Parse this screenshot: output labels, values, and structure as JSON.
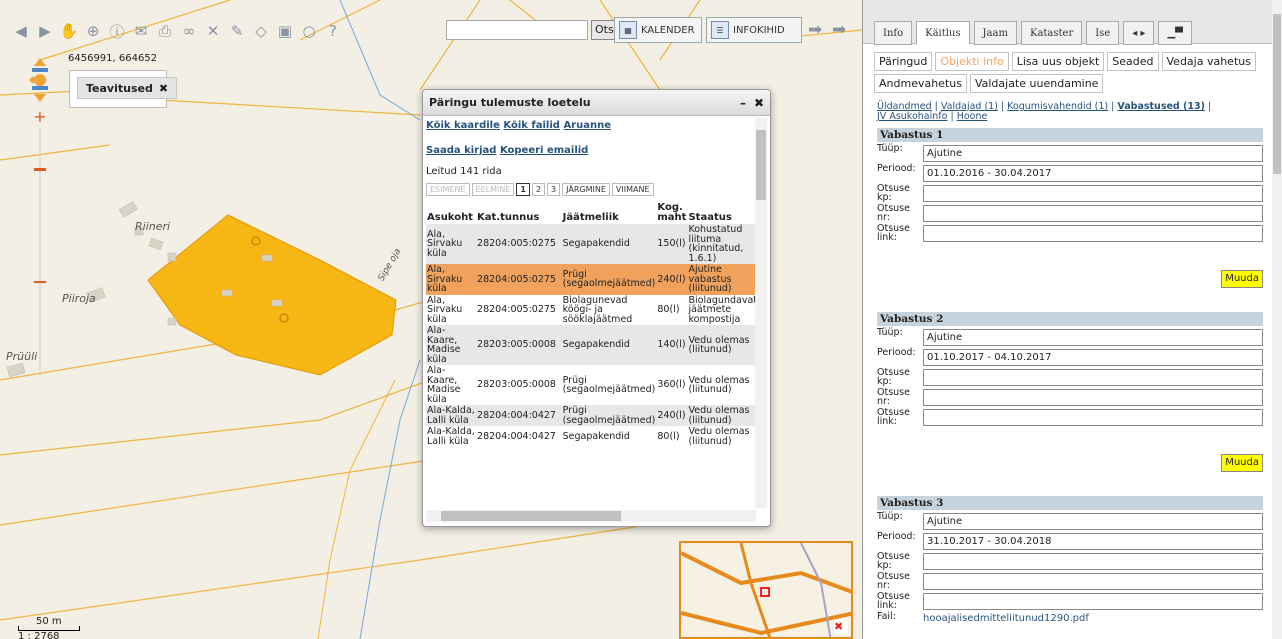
{
  "toolbar": {
    "search_value": "",
    "search_button": "Otsi",
    "calendar_label": "KALENDER",
    "info_label": "INFOKIHID",
    "help_label": "?"
  },
  "map": {
    "coords": "6456991, 664652",
    "notifications_chip": "Teavitused",
    "labels": [
      "Riineri",
      "Piiroja",
      "Prüüli",
      "Sipe oja"
    ],
    "scale_label": "50 m",
    "scale_ratio": "1 : 2768",
    "parcel_color": "#f6b614"
  },
  "dialog": {
    "title": "Päringu tulemuste loetelu",
    "links1": [
      "Kõik kaardile",
      "Kõik failid",
      "Aruanne"
    ],
    "links2": [
      "Saada kirjad",
      "Kopeeri emailid"
    ],
    "found": "Leitud 141 rida",
    "pager": [
      "ESIMENE",
      "EELMINE",
      "1",
      "2",
      "3",
      "JÄRGMINE",
      "VIIMANE"
    ],
    "columns": [
      "Asukoht",
      "Kat.tunnus",
      "Jäätmeliik",
      "Kog. maht",
      "Staatus"
    ],
    "rows": [
      [
        "Ala, Sirvaku küla",
        "28204:005:0275",
        "Segapakendid",
        "150(l)",
        "Kohustatud liituma (kinnitatud, 1.6.1)"
      ],
      [
        "Ala, Sirvaku küla",
        "28204:005:0275",
        "Prügi (segaolmejäätmed)",
        "240(l)",
        "Ajutine vabastus (liitunud)"
      ],
      [
        "Ala, Sirvaku küla",
        "28204:005:0275",
        "Biolagunevad köögi- ja sööklajäätmed",
        "80(l)",
        "Biolagundavat jäätmete kompostija"
      ],
      [
        "Ala-Kaare, Madise küla",
        "28203:005:0008",
        "Segapakendid",
        "140(l)",
        "Vedu olemas (liitunud)"
      ],
      [
        "Ala-Kaare, Madise küla",
        "28203:005:0008",
        "Prügi (segaolmejäätmed)",
        "360(l)",
        "Vedu olemas (liitunud)"
      ],
      [
        "Ala-Kalda, Lalli küla",
        "28204:004:0427",
        "Prügi (segaolmejäätmed)",
        "240(l)",
        "Vedu olemas (liitunud)"
      ],
      [
        "Ala-Kalda, Lalli küla",
        "28204:004:0427",
        "Segapakendid",
        "80(l)",
        "Vedu olemas (liitunud)"
      ]
    ],
    "highlight_color": "#f0a25d"
  },
  "panel": {
    "tabs": [
      "Info",
      "Käitlus",
      "Jaam",
      "Kataster",
      "Ise"
    ],
    "subtabs": [
      "Päringud",
      "Objekti info",
      "Lisa uus objekt",
      "Seaded",
      "Vedaja vahetus",
      "Andmevahetus",
      "Valdajate uuendamine"
    ],
    "crumbs": {
      "c1": "Üldandmed",
      "c2": "Valdajad (1)",
      "c3": "Kogumisvahendid (1)",
      "c4": "Vabastused (13)",
      "c5": "JV Asukohainfo",
      "c6": "Hoone"
    },
    "field_labels": {
      "tyyp": "Tüüp:",
      "periood": "Periood:",
      "kp": "Otsuse kp:",
      "nr": "Otsuse nr:",
      "link": "Otsuse link:",
      "fail": "Fail:"
    },
    "vabastused": [
      {
        "title": "Vabastus 1",
        "tyyp": "Ajutine",
        "periood": "01.10.2016 - 30.04.2017",
        "kp": "",
        "nr": "",
        "link": ""
      },
      {
        "title": "Vabastus 2",
        "tyyp": "Ajutine",
        "periood": "01.10.2017 - 04.10.2017",
        "kp": "",
        "nr": "",
        "link": ""
      },
      {
        "title": "Vabastus 3",
        "tyyp": "Ajutine",
        "periood": "31.10.2017 - 30.04.2018",
        "kp": "",
        "nr": "",
        "link": "",
        "fail": "hooajalisedmitteliitunud1290.pdf"
      }
    ],
    "muuda_label": "Muuda",
    "muuda_color": "#ffff00"
  }
}
